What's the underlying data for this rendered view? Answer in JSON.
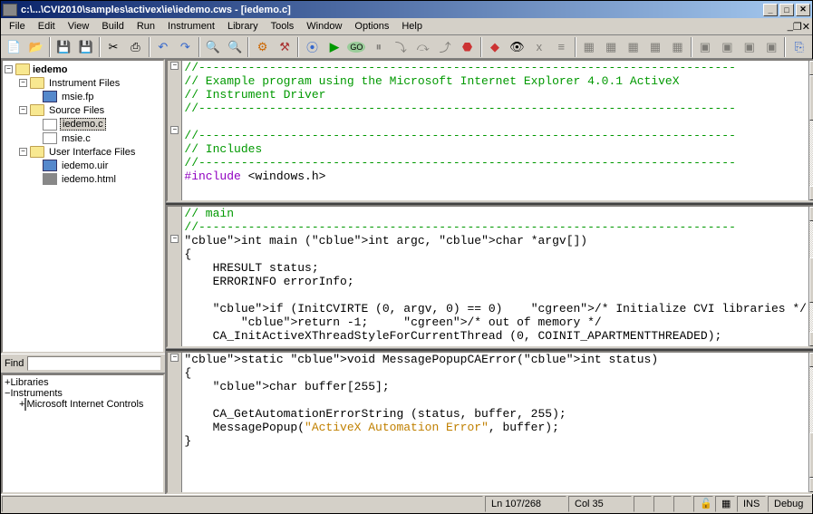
{
  "title": "c:\\...\\CVI2010\\samples\\activex\\ie\\iedemo.cws - [iedemo.c]",
  "menu": [
    "File",
    "Edit",
    "View",
    "Build",
    "Run",
    "Instrument",
    "Library",
    "Tools",
    "Window",
    "Options",
    "Help"
  ],
  "project": {
    "root": "iedemo",
    "groups": [
      {
        "label": "Instrument Files",
        "items": [
          {
            "label": "msie.fp",
            "icon": "file-blue"
          }
        ]
      },
      {
        "label": "Source Files",
        "items": [
          {
            "label": "iedemo.c",
            "icon": "file-c",
            "selected": true
          },
          {
            "label": "msie.c",
            "icon": "file-c"
          }
        ]
      },
      {
        "label": "User Interface Files",
        "items": [
          {
            "label": "iedemo.uir",
            "icon": "file-blue"
          },
          {
            "label": "iedemo.html",
            "icon": "file-dia"
          }
        ]
      }
    ]
  },
  "find_label": "Find",
  "libs": {
    "root1": "Libraries",
    "root2": "Instruments",
    "item": "Microsoft Internet Controls"
  },
  "code1": "//----------------------------------------------------------------------------\n// Example program using the Microsoft Internet Explorer 4.0.1 ActiveX\n// Instrument Driver\n//----------------------------------------------------------------------------\n\n//----------------------------------------------------------------------------\n// Includes\n//----------------------------------------------------------------------------\n#include <windows.h>",
  "code2_a": "// main\n//----------------------------------------------------------------------------",
  "code2_b": "int main (int argc, char *argv[])",
  "code2_c": "{\n    HRESULT status;\n    ERRORINFO errorInfo;\n\n    if (InitCVIRTE (0, argv, 0) == 0)    /* Initialize CVI libraries */\n        return -1;     /* out of memory */\n    CA_InitActiveXThreadStyleForCurrentThread (0, COINIT_APARTMENTTHREADED);",
  "code3_a": "static void MessagePopupCAError(int status)",
  "code3_b": "{\n    char buffer[255];\n\n    CA_GetAutomationErrorString (status, buffer, 255);\n    MessagePopup(\"ActiveX Automation Error\", buffer);\n}",
  "status": {
    "line": "Ln 107/268",
    "col": "Col 35",
    "ins": "INS",
    "debug": "Debug"
  }
}
